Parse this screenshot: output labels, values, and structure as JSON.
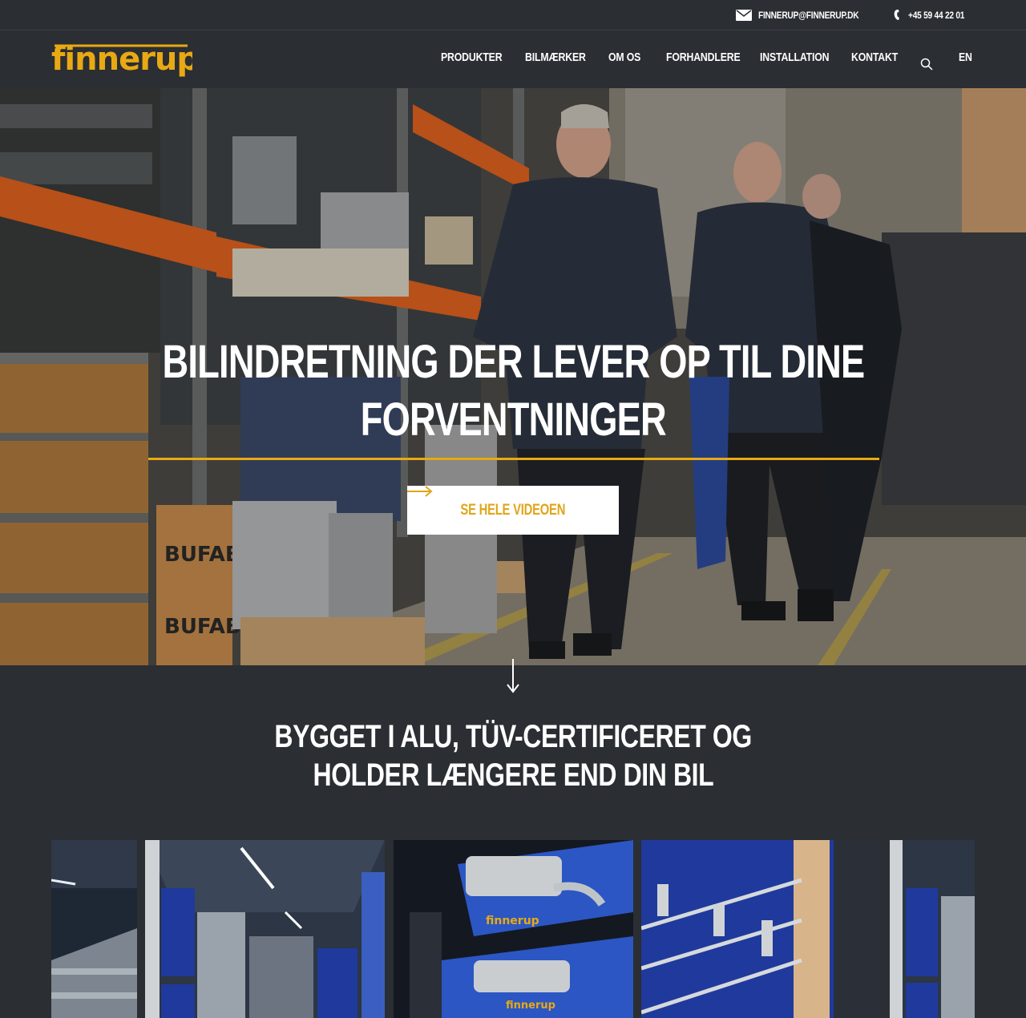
{
  "topbar": {
    "email": "FINNERUP@FINNERUP.DK",
    "phone": "+45 59 44 22 01"
  },
  "header": {
    "logo_text": "finnerup",
    "nav": [
      {
        "label": "PRODUKTER"
      },
      {
        "label": "BILMÆRKER"
      },
      {
        "label": "OM OS"
      },
      {
        "label": "FORHANDLERE"
      },
      {
        "label": "INSTALLATION"
      },
      {
        "label": "KONTAKT"
      }
    ],
    "language": "EN"
  },
  "hero": {
    "title_line1": "BILINDRETNING DER LEVER OP TIL DINE",
    "title_line2": "FORVENTNINGER",
    "button_label": "SE HELE VIDEOEN",
    "crate_label": "BUFAB"
  },
  "section": {
    "title_line1": "BYGGET I ALU, TÜV-CERTIFICERET OG",
    "title_line2": "HOLDER LÆNGERE END DIN BIL"
  },
  "gallery": {
    "tile_text": "finnerup"
  },
  "colors": {
    "background": "#2b2e32",
    "accent": "#e8a913",
    "button_text": "#e0a51a",
    "shelf_orange": "#e0621f",
    "panel_blue": "#1f3a9c"
  },
  "icons": {
    "email": "mail-icon",
    "phone": "phone-icon",
    "search": "search-icon",
    "button_arrow": "arrow-right-icon",
    "scroll": "arrow-down-icon"
  }
}
